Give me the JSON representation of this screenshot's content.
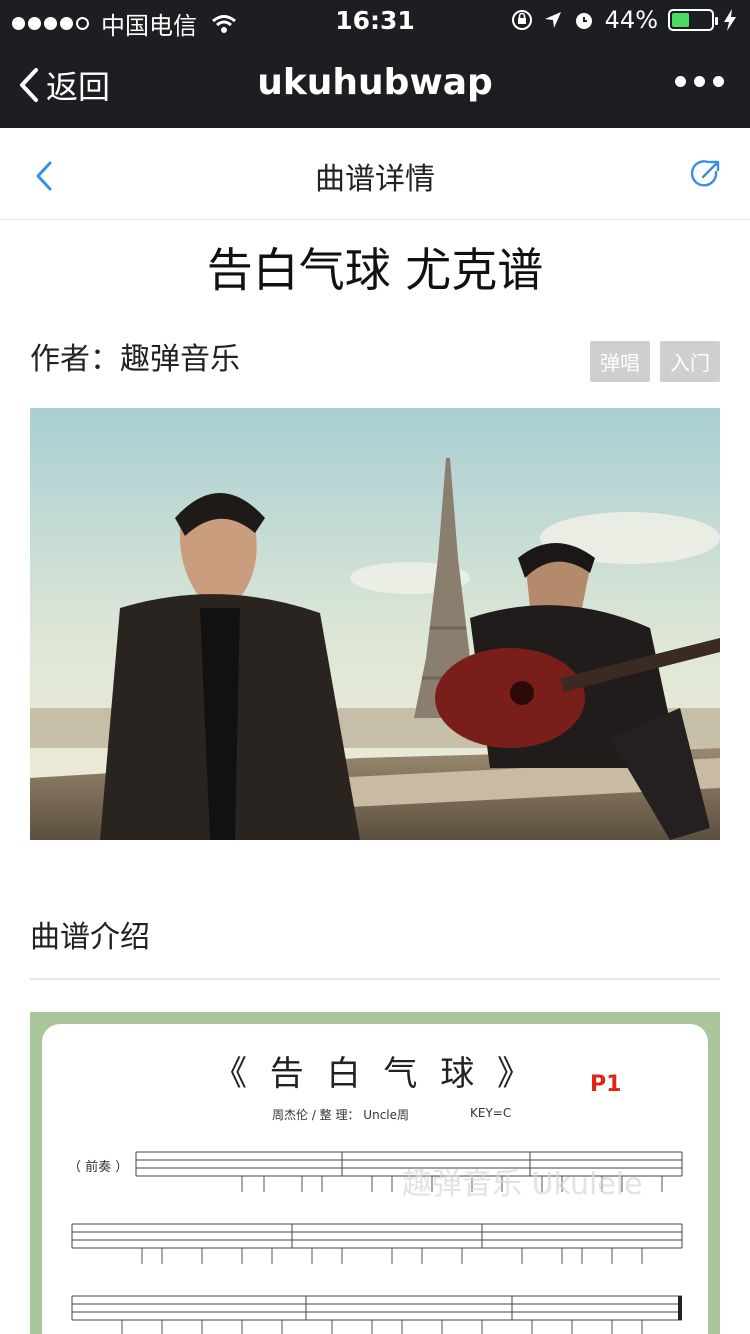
{
  "status": {
    "carrier": "中国电信",
    "time": "16:31",
    "battery": "44%",
    "battery_level": 0.44
  },
  "nav": {
    "back_label": "返回",
    "title": "ukuhubwap"
  },
  "page": {
    "title": "曲谱详情"
  },
  "song": {
    "title": "告白气球 尤克谱",
    "author": "作者：趣弹音乐",
    "tags": [
      "弹唱",
      "入门"
    ]
  },
  "section": {
    "title": "曲谱介绍"
  },
  "score": {
    "title": "《 告 白 气 球 》",
    "page": "P1",
    "subtitle": "周杰伦 / 整 理： Uncle周",
    "key": "KEY=C",
    "prelude": "（ 前奏 ）"
  },
  "colors": {
    "topbar": "#1d1e22",
    "accent_blue": "#3a8ee6",
    "tag_bg": "#cfcfcf",
    "score_border": "#a9c79b",
    "score_page_red": "#e0241a"
  }
}
